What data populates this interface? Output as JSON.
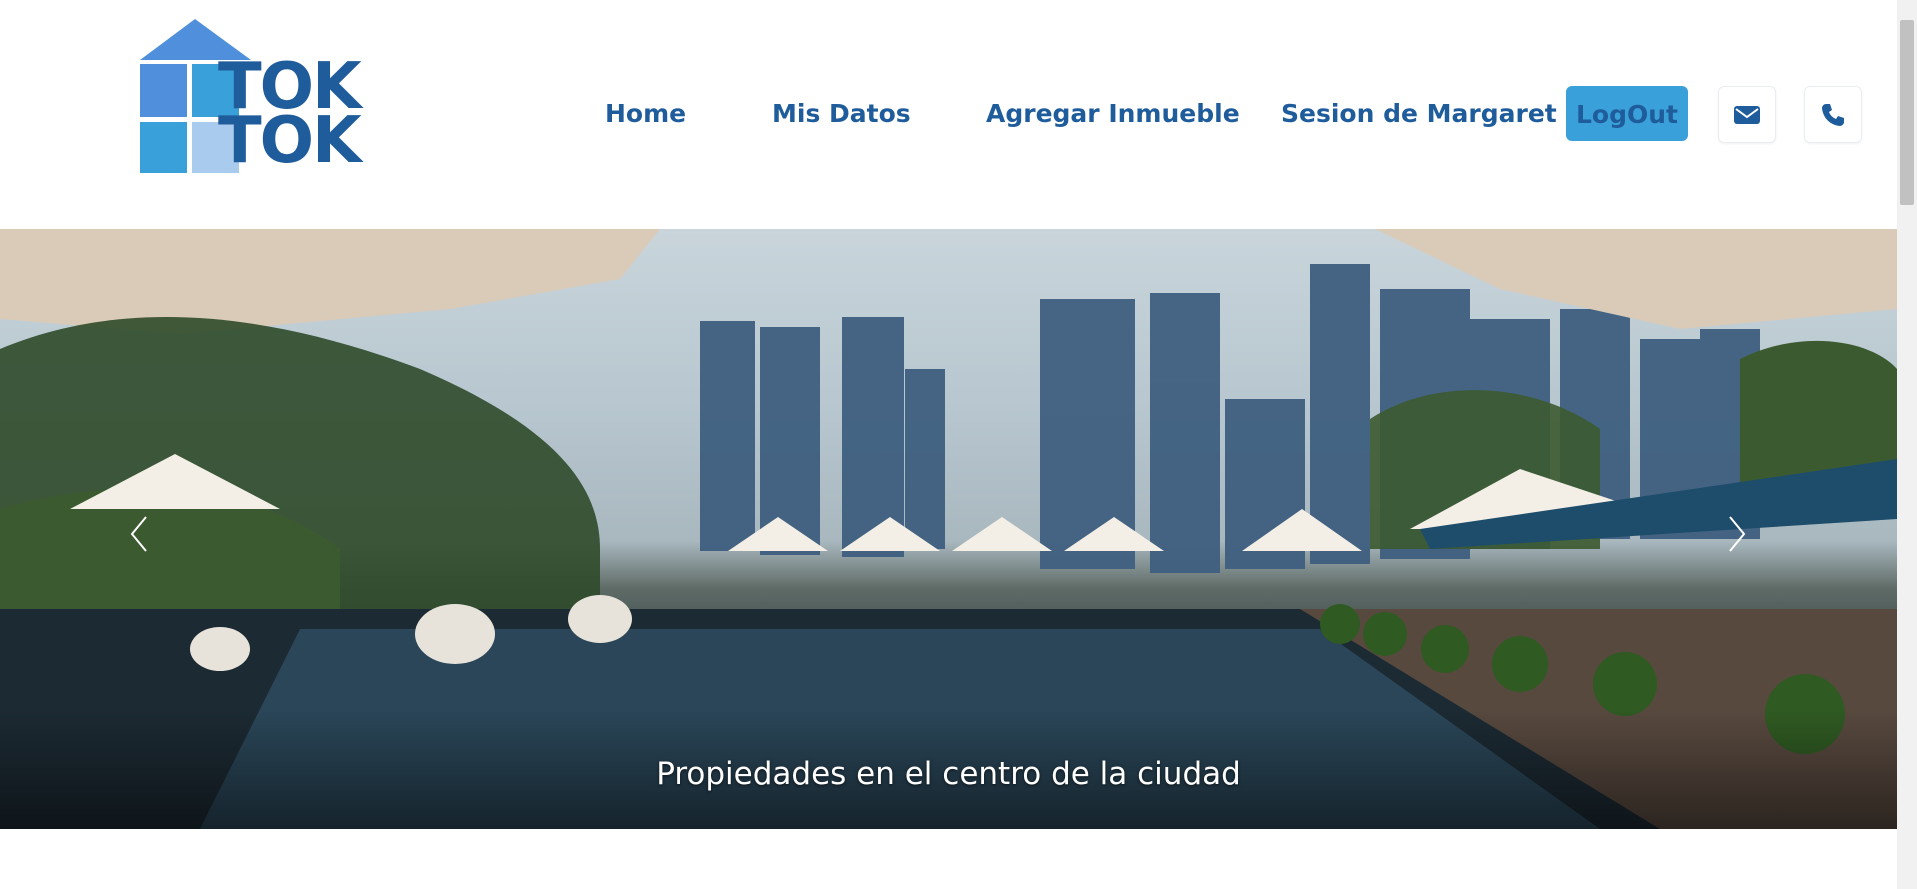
{
  "brand": {
    "line1": "TOK",
    "line2": "TOK"
  },
  "nav": {
    "home": "Home",
    "mis_datos": "Mis Datos",
    "agregar_inmueble": "Agregar Inmueble",
    "sesion": "Sesion de Margaret",
    "logout": "LogOut"
  },
  "icons": {
    "mail": "envelope-icon",
    "phone": "phone-icon"
  },
  "hero": {
    "caption": "Propiedades en el centro de la ciudad"
  },
  "colors": {
    "brand_dark": "#1f5c9b",
    "brand_light": "#3aa0d9",
    "logo_blue": "#4f8fdb"
  }
}
